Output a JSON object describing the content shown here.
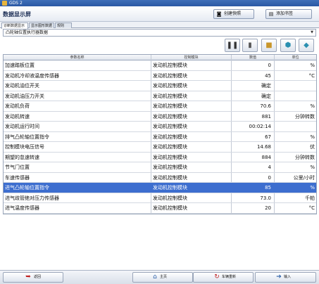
{
  "window": {
    "title": "GDS 2"
  },
  "header": {
    "page_title": "数据显示屏",
    "snapshot_label": "创建快照",
    "add_record_label": "添加书签"
  },
  "tabs": [
    {
      "label": "诊断数据显示屏"
    },
    {
      "label": "显示图形数据"
    },
    {
      "label": "规则"
    }
  ],
  "selector": {
    "value": "凸轮轴位置执行器数据"
  },
  "grid": {
    "columns": {
      "name": "参数名称",
      "module": "控制模块",
      "value": "数值",
      "unit": "单位"
    },
    "rows": [
      {
        "name": "加速踏板位置",
        "module": "发动机控制模块",
        "value": "0",
        "unit": "%"
      },
      {
        "name": "发动机冷却液温度传感器",
        "module": "发动机控制模块",
        "value": "45",
        "unit": "°C"
      },
      {
        "name": "发动机油位开关",
        "module": "发动机控制模块",
        "value": "确定",
        "unit": ""
      },
      {
        "name": "发动机油压力开关",
        "module": "发动机控制模块",
        "value": "确定",
        "unit": ""
      },
      {
        "name": "发动机负荷",
        "module": "发动机控制模块",
        "value": "70.6",
        "unit": "%"
      },
      {
        "name": "发动机转速",
        "module": "发动机控制模块",
        "value": "881",
        "unit": "分钟转数"
      },
      {
        "name": "发动机运行时间",
        "module": "发动机控制模块",
        "value": "00:02:14",
        "unit": ""
      },
      {
        "name": "排气凸轮轴位置指令",
        "module": "发动机控制模块",
        "value": "67",
        "unit": "%"
      },
      {
        "name": "控制模块电压信号",
        "module": "发动机控制模块",
        "value": "14.68",
        "unit": "伏"
      },
      {
        "name": "期望的怠速转速",
        "module": "发动机控制模块",
        "value": "884",
        "unit": "分钟转数"
      },
      {
        "name": "节气门位置",
        "module": "发动机控制模块",
        "value": "4",
        "unit": "%"
      },
      {
        "name": "车速传感器",
        "module": "发动机控制模块",
        "value": "0",
        "unit": "公里/小时"
      },
      {
        "name": "进气凸轮轴位置指令",
        "module": "发动机控制模块",
        "value": "85",
        "unit": "%"
      },
      {
        "name": "进气歧管绝对压力传感器",
        "module": "发动机控制模块",
        "value": "73.0",
        "unit": "千帕"
      },
      {
        "name": "进气温度传感器",
        "module": "发动机控制模块",
        "value": "20",
        "unit": "°C"
      }
    ],
    "selected_row": 12
  },
  "toolbar_icons": [
    "pause-icon",
    "clear-icon",
    "lock-icon",
    "save-icon",
    "down-icon"
  ],
  "bottom": {
    "back_label": "返回",
    "main_label": "主页",
    "record_label": "车辆重新",
    "import_label": "输入"
  }
}
